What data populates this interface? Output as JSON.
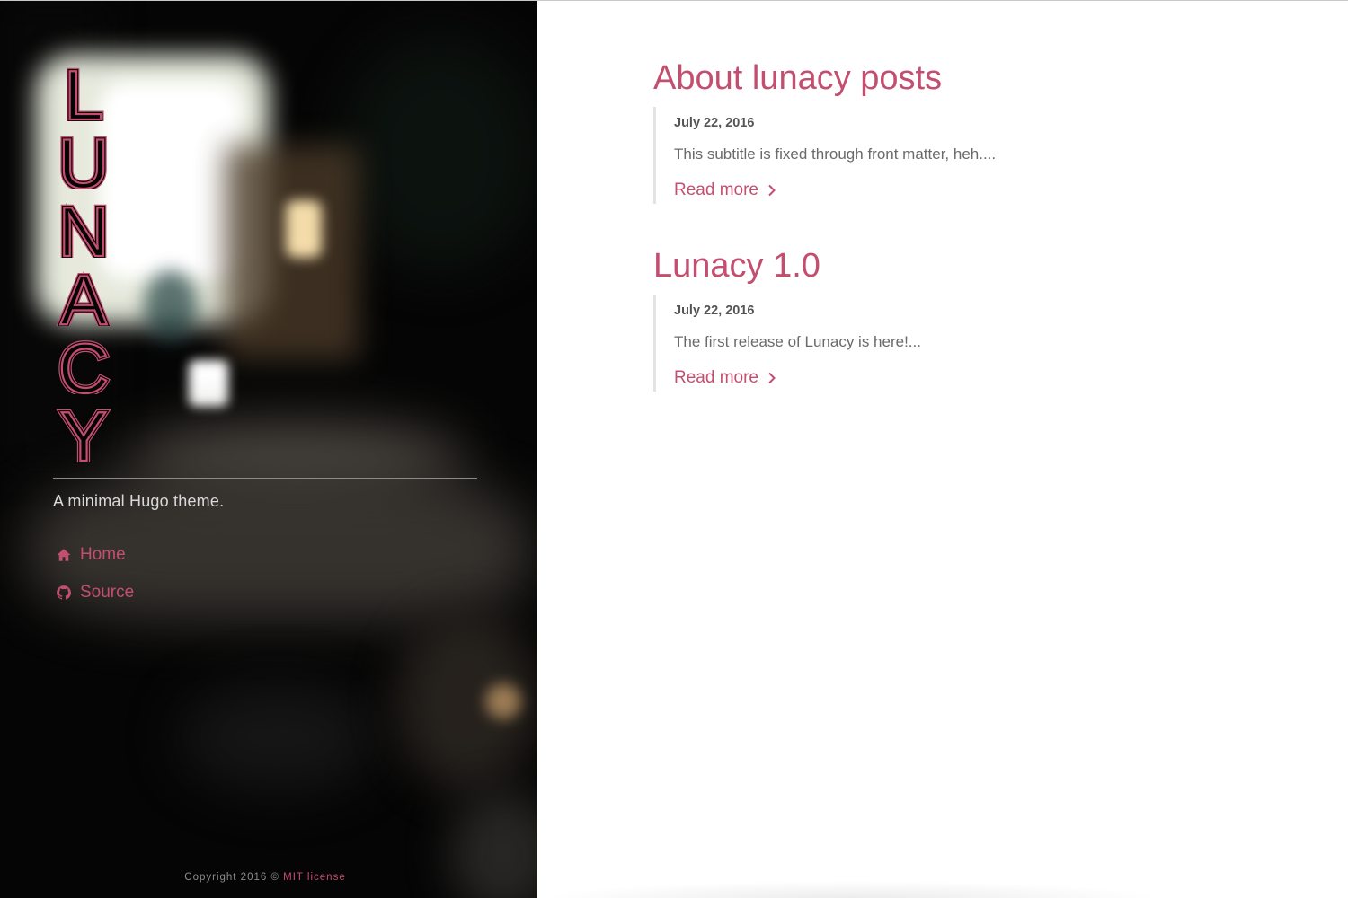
{
  "site": {
    "logo_letters": [
      "L",
      "U",
      "N",
      "A",
      "C",
      "Y"
    ],
    "tagline": "A minimal Hugo theme.",
    "accent_color": "#c44e70"
  },
  "nav": {
    "items": [
      {
        "label": "Home",
        "icon": "home-icon"
      },
      {
        "label": "Source",
        "icon": "github-icon"
      }
    ]
  },
  "footer": {
    "copyright": "Copyright 2016 © ",
    "license": "MIT license"
  },
  "posts": [
    {
      "title": "About lunacy posts",
      "date": "July 22, 2016",
      "summary": "This subtitle is fixed through front matter, heh....",
      "read_more": "Read more"
    },
    {
      "title": "Lunacy 1.0",
      "date": "July 22, 2016",
      "summary": "The first release of Lunacy is here!...",
      "read_more": "Read more"
    }
  ]
}
